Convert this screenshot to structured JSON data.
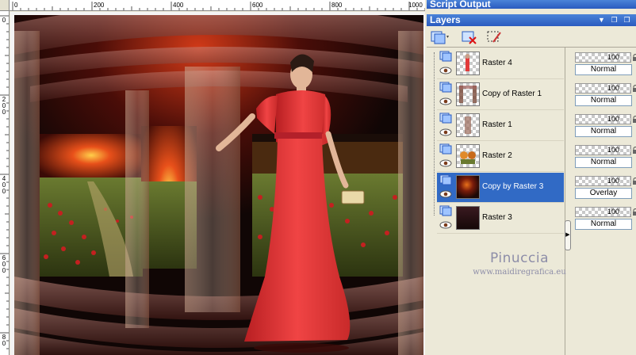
{
  "panels": {
    "script_output_title": "Script Output",
    "layers_title": "Layers"
  },
  "ruler": {
    "h_labels": [
      "0",
      "200",
      "400",
      "600",
      "800",
      "1000"
    ],
    "v_labels": [
      "0",
      "2 0 0",
      "4 0 0",
      "6 0 0",
      "8 0"
    ]
  },
  "layers": [
    {
      "name": "Raster 4",
      "opacity": "100",
      "blend": "Normal",
      "thumb": "checker-red",
      "selected": false
    },
    {
      "name": "Copy of Raster 1",
      "opacity": "100",
      "blend": "Normal",
      "thumb": "checker-pillars",
      "selected": false
    },
    {
      "name": "Raster 1",
      "opacity": "100",
      "blend": "Normal",
      "thumb": "checker-pillar",
      "selected": false
    },
    {
      "name": "Raster 2",
      "opacity": "100",
      "blend": "Normal",
      "thumb": "checker-flowers",
      "selected": false
    },
    {
      "name": "Copy by Raster 3",
      "opacity": "100",
      "blend": "Overlay",
      "thumb": "dark-orange",
      "selected": true
    },
    {
      "name": "Raster 3",
      "opacity": "100",
      "blend": "Normal",
      "thumb": "dark",
      "selected": false
    }
  ],
  "watermark": {
    "name": "Pinuccia",
    "url": "www.maidiregrafica.eu"
  },
  "colors": {
    "title_bar": "#2a5bbf",
    "selected_row": "#316ac5",
    "panel_bg": "#ece9d8",
    "dress_red": "#e23a3a"
  }
}
